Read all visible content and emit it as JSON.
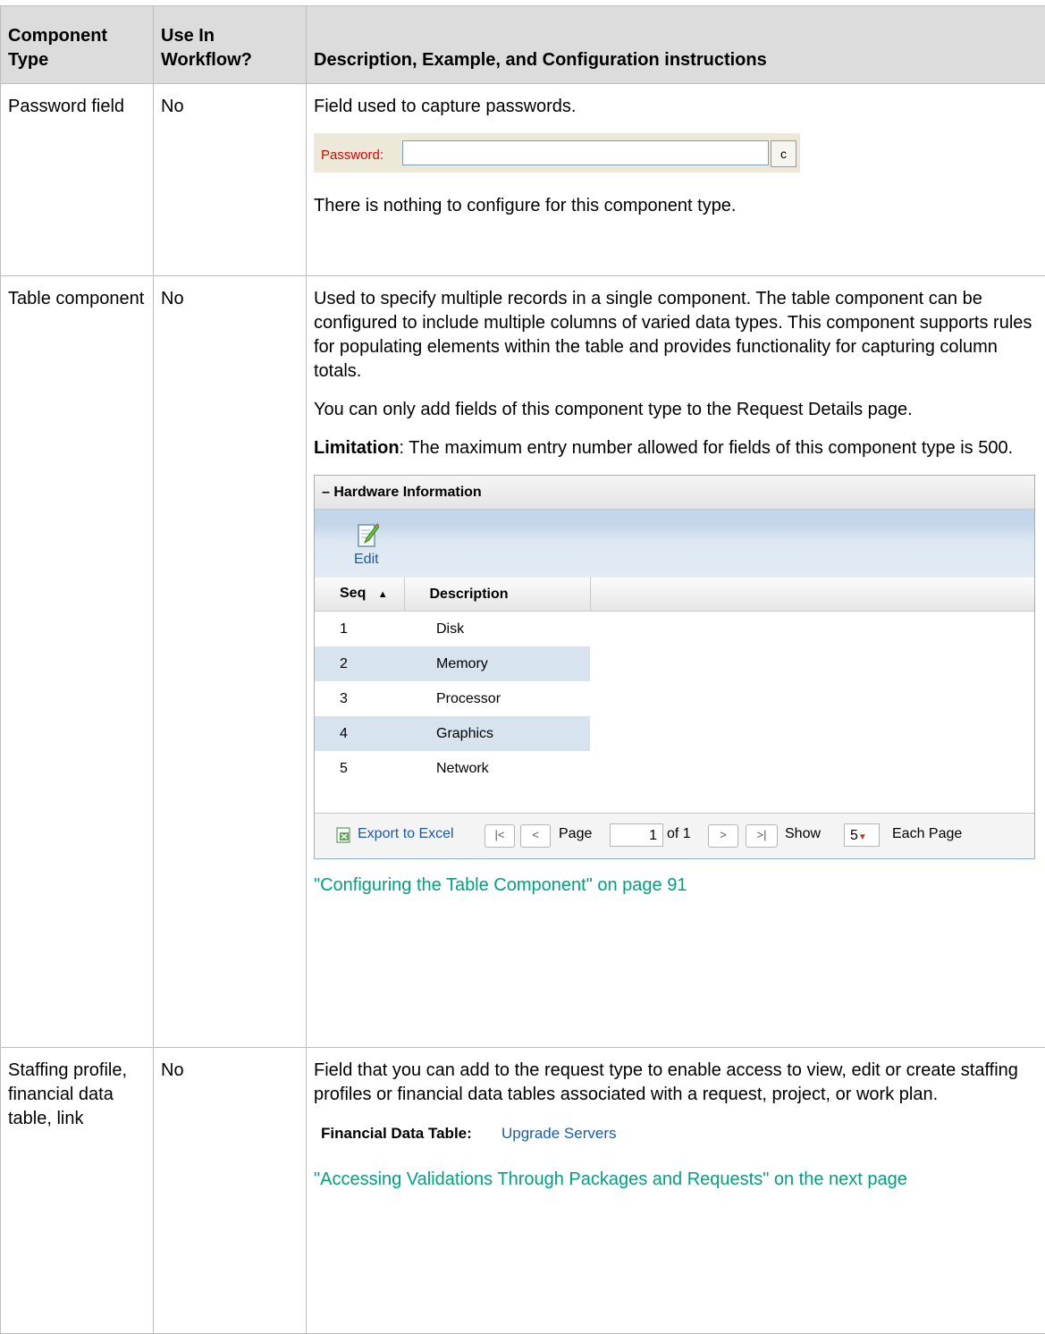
{
  "table": {
    "headers": {
      "type": "Component Type",
      "workflow": "Use In Workflow?",
      "description": "Description, Example, and Configuration instructions"
    },
    "rows": [
      {
        "type": "Password field",
        "workflow": "No",
        "desc_1": "Field used to capture passwords.",
        "example": {
          "label": "Password:",
          "button": "c"
        },
        "desc_2": "There is nothing to configure for this component type."
      },
      {
        "type": "Table component",
        "workflow": "No",
        "desc_1": "Used to specify multiple records in a single component. The table component can be configured to include multiple columns of varied data types. This component supports rules for populating elements within the table and provides functionality for capturing column totals.",
        "desc_2": "You can only add fields of this component type to the Request Details page.",
        "limitation_label": "Limitation",
        "limitation_text": ": The maximum entry number allowed for fields of this component type is 500.",
        "example": {
          "title": "– Hardware Information",
          "edit_label": "Edit",
          "columns": {
            "seq": "Seq",
            "sort_indicator": "▲",
            "description": "Description"
          },
          "rows": [
            {
              "seq": "1",
              "description": "Disk"
            },
            {
              "seq": "2",
              "description": "Memory"
            },
            {
              "seq": "3",
              "description": "Processor"
            },
            {
              "seq": "4",
              "description": "Graphics"
            },
            {
              "seq": "5",
              "description": "Network"
            }
          ],
          "pager": {
            "export": "Export to Excel",
            "first": "|<",
            "prev": "<",
            "page_label": "Page",
            "page_value": "1",
            "of": "of 1",
            "next": ">",
            "last": ">|",
            "show": "Show",
            "page_size": "5",
            "each_page": "Each Page"
          }
        },
        "link": "\"Configuring the Table Component\" on page 91"
      },
      {
        "type": "Staffing profile, financial data table, link",
        "workflow": "No",
        "desc_1": "Field that you can add to the request type to enable access to view, edit or create staffing profiles or financial data tables associated with a request, project, or work plan.",
        "example": {
          "label": "Financial Data Table:",
          "value": "Upgrade Servers"
        },
        "link": "\"Accessing Validations Through Packages and Requests\" on the next page"
      }
    ]
  },
  "colors": {
    "link": "#00a081",
    "grid_alt_row": "#d7e3ee",
    "header_bg": "#dcdcdc"
  }
}
